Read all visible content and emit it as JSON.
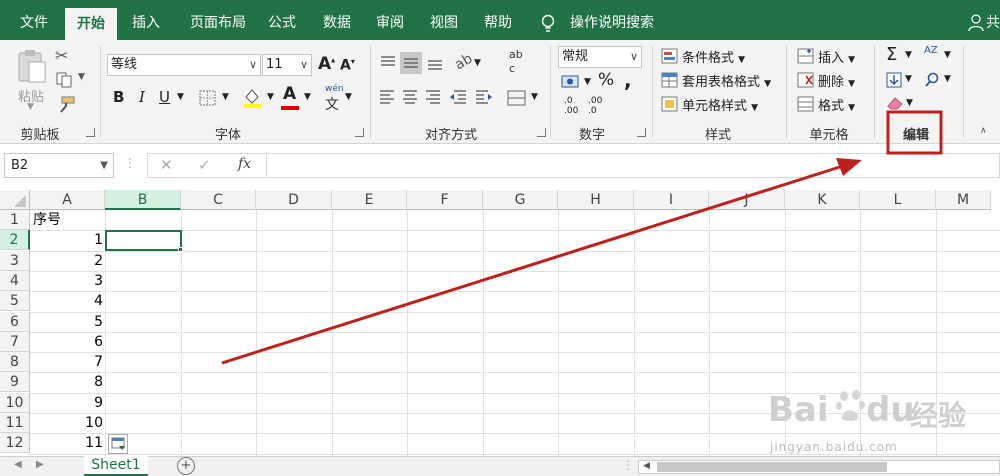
{
  "tabs": [
    {
      "label": "文件",
      "active": false
    },
    {
      "label": "开始",
      "active": true
    },
    {
      "label": "插入",
      "active": false
    },
    {
      "label": "页面布局",
      "active": false
    },
    {
      "label": "公式",
      "active": false
    },
    {
      "label": "数据",
      "active": false
    },
    {
      "label": "审阅",
      "active": false
    },
    {
      "label": "视图",
      "active": false
    },
    {
      "label": "帮助",
      "active": false
    }
  ],
  "tell_me": "操作说明搜索",
  "share_label": "共",
  "ribbon": {
    "clipboard": {
      "label": "剪贴板",
      "paste": "粘贴"
    },
    "font": {
      "label": "字体",
      "font_name": "等线",
      "font_size": "11",
      "bold": "B",
      "italic": "I",
      "underline": "U",
      "wen": "wén",
      "wen_char": "文"
    },
    "alignment": {
      "label": "对齐方式",
      "wrap_top": "ab",
      "wrap_bottom": "c"
    },
    "number": {
      "label": "数字",
      "format": "常规",
      "percent": "%",
      "comma": ",",
      "inc_decimal": ".0",
      "inc_decimal_2": ".00",
      "dec_decimal": ".00",
      "dec_decimal_2": ".0"
    },
    "styles": {
      "label": "样式",
      "conditional": "条件格式",
      "table_format": "套用表格格式",
      "cell_styles": "单元格样式"
    },
    "cells": {
      "label": "单元格",
      "insert": "插入",
      "delete": "删除",
      "format": "格式"
    },
    "editing": {
      "label": "编辑",
      "sigma": "Σ",
      "sort": "AZ"
    }
  },
  "formula_bar": {
    "name_box": "B2",
    "fx": "fx",
    "cancel": "✕",
    "enter": "✓",
    "value": ""
  },
  "columns": [
    "A",
    "B",
    "C",
    "D",
    "E",
    "F",
    "G",
    "H",
    "I",
    "J",
    "K",
    "L",
    "M"
  ],
  "rows": [
    "1",
    "2",
    "3",
    "4",
    "5",
    "6",
    "7",
    "8",
    "9",
    "10",
    "11",
    "12"
  ],
  "cells": {
    "a1": "序号",
    "a_values": [
      "1",
      "2",
      "3",
      "4",
      "5",
      "6",
      "7",
      "8",
      "9",
      "10",
      "11"
    ]
  },
  "sheet": {
    "name": "Sheet1",
    "add": "+"
  },
  "watermark": {
    "brand": "Bai",
    "brand2": "du",
    "brand_cn": "经验",
    "url": "jingyan.baidu.com"
  },
  "colors": {
    "accent": "#217346",
    "annotation": "#c0201c"
  }
}
